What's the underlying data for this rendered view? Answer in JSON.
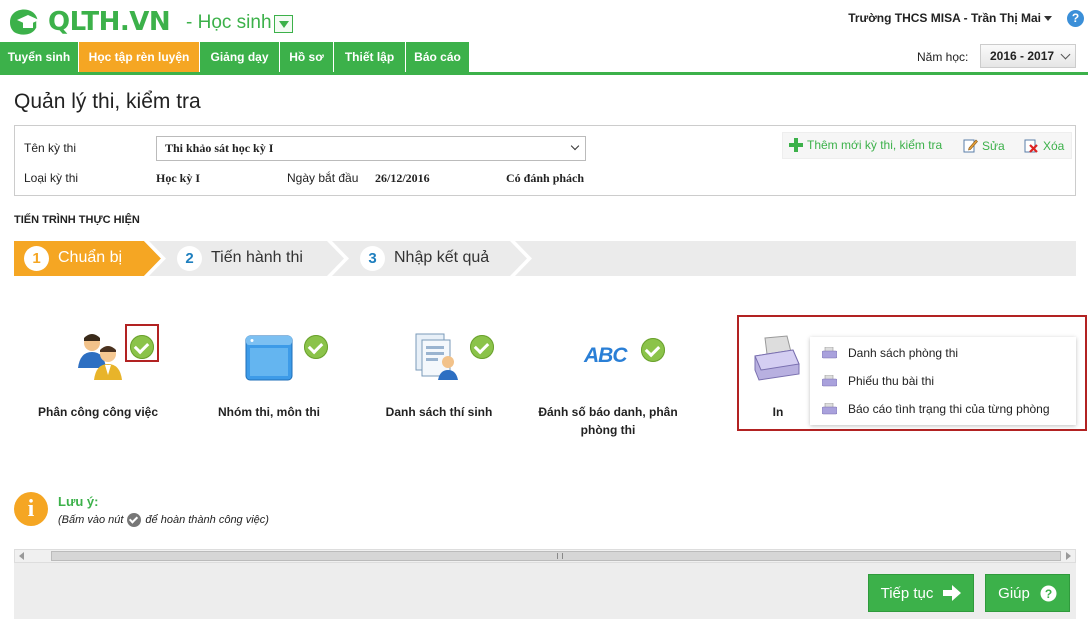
{
  "header": {
    "brand": "QLTH.VN",
    "role": "- Học sinh",
    "user": "Trường THCS MISA - Trần Thị Mai",
    "help": "?"
  },
  "nav": {
    "items": [
      {
        "label": "Tuyển sinh",
        "active": false
      },
      {
        "label": "Học tập rèn luyện",
        "active": true
      },
      {
        "label": "Giảng dạy",
        "active": false
      },
      {
        "label": "Hồ sơ",
        "active": false
      },
      {
        "label": "Thiết lập",
        "active": false
      },
      {
        "label": "Báo cáo",
        "active": false
      }
    ],
    "year_label": "Năm học:",
    "year_value": "2016 - 2017"
  },
  "page": {
    "title": "Quản lý thi, kiểm tra"
  },
  "info": {
    "exam_name_label": "Tên kỳ thi",
    "exam_name_value": "Thi khảo sát học kỳ I",
    "exam_type_label": "Loại kỳ thi",
    "exam_type_value": "Học kỳ I",
    "start_date_label": "Ngày bắt đầu",
    "start_date_value": "26/12/2016",
    "sealing_value": "Có đánh phách",
    "actions": {
      "add": "Thêm mới kỳ thi, kiểm tra",
      "edit": "Sửa",
      "delete": "Xóa"
    }
  },
  "process": {
    "title": "TIẾN TRÌNH THỰC HIỆN",
    "steps": [
      {
        "num": "1",
        "label": "Chuẩn bị",
        "active": true
      },
      {
        "num": "2",
        "label": "Tiến hành thi",
        "active": false
      },
      {
        "num": "3",
        "label": "Nhập kết quả",
        "active": false
      }
    ]
  },
  "tasks": {
    "assign": "Phân công công việc",
    "groups": "Nhóm thi, môn thi",
    "students": "Danh sách thí sinh",
    "numbering": "Đánh số báo danh, phân phòng thi",
    "numbering_icon_text": "ABC",
    "print": "In"
  },
  "print_menu": {
    "items": [
      "Danh sách phòng thi",
      "Phiếu thu bài thi",
      "Báo cáo tình trạng thi của từng phòng"
    ]
  },
  "note": {
    "icon": "i",
    "title": "Lưu ý:",
    "text_before": "(Bấm vào nút",
    "text_after": "để hoàn thành công việc)"
  },
  "footer": {
    "next": "Tiếp tục",
    "help": "Giúp"
  },
  "colors": {
    "brand_green": "#3cb14a",
    "active_orange": "#f5a623",
    "check_green": "#8bc34a",
    "highlight_red": "#b22222"
  }
}
